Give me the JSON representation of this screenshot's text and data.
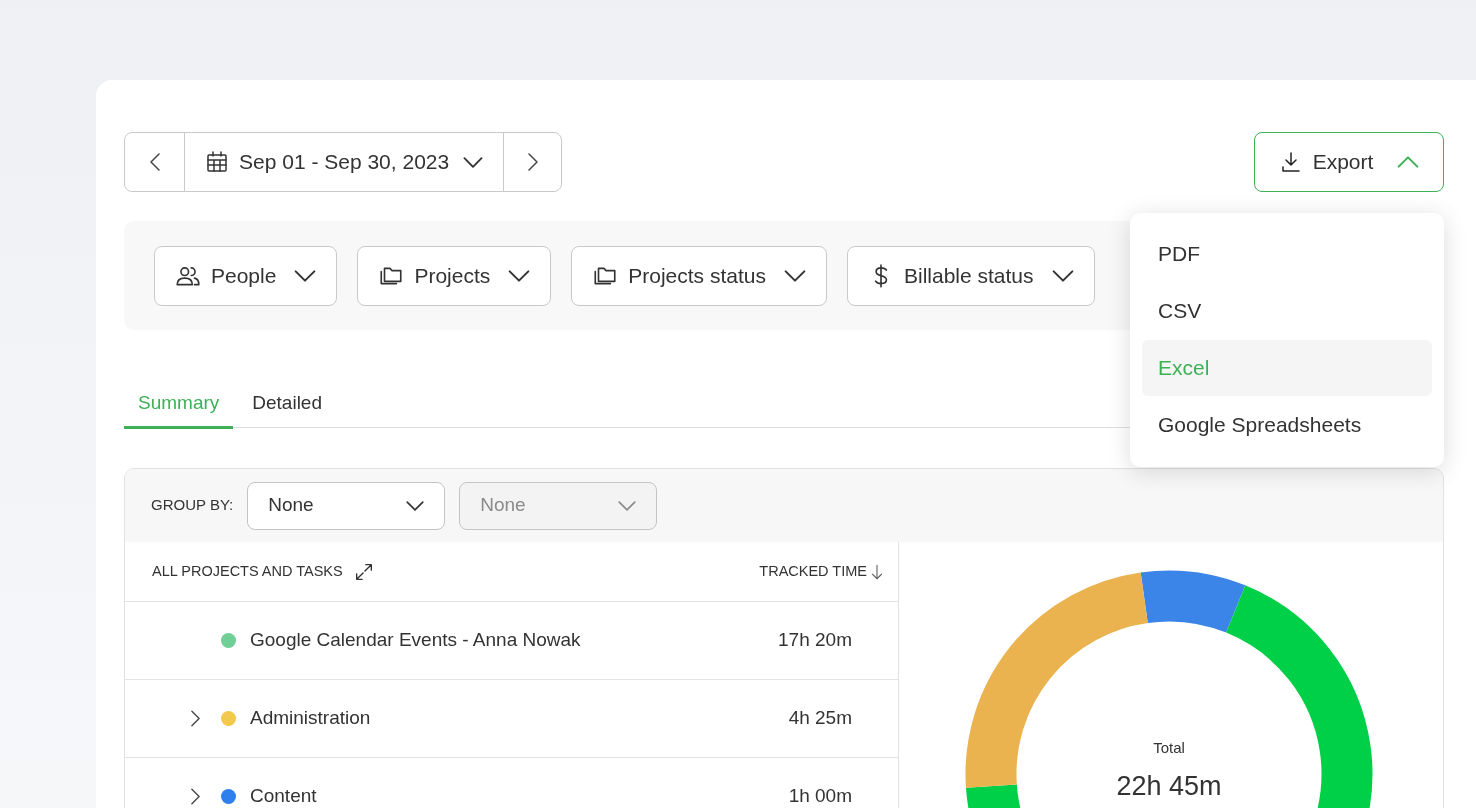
{
  "date_range": {
    "label": "Sep 01 - Sep 30, 2023"
  },
  "export": {
    "label": "Export",
    "expanded": true,
    "menu": [
      {
        "label": "PDF",
        "selected": false
      },
      {
        "label": "CSV",
        "selected": false
      },
      {
        "label": "Excel",
        "selected": true
      },
      {
        "label": "Google Spreadsheets",
        "selected": false
      }
    ]
  },
  "filters": [
    {
      "label": "People",
      "kind": "people"
    },
    {
      "label": "Projects",
      "kind": "projects"
    },
    {
      "label": "Projects status",
      "kind": "projects"
    },
    {
      "label": "Billable status",
      "kind": "billable"
    }
  ],
  "tabs": [
    {
      "label": "Summary",
      "selected": true
    },
    {
      "label": "Detailed",
      "selected": false
    }
  ],
  "group_by": {
    "label": "GROUP BY:",
    "selects": [
      {
        "value": "None",
        "disabled": false
      },
      {
        "value": "None",
        "disabled": true
      }
    ]
  },
  "table": {
    "columns": [
      "ALL PROJECTS AND TASKS",
      "TRACKED TIME"
    ],
    "rows": [
      {
        "name": "Google Calendar Events - Anna Nowak",
        "time": "17h 20m",
        "color": "#6fcf97",
        "expandable": false
      },
      {
        "name": "Administration",
        "time": "4h 25m",
        "color": "#f2c94c",
        "expandable": true
      },
      {
        "name": "Content",
        "time": "1h 00m",
        "color": "#2f80ed",
        "expandable": true
      }
    ]
  },
  "chart": {
    "total_label": "Total",
    "total": "22h 45m"
  }
}
